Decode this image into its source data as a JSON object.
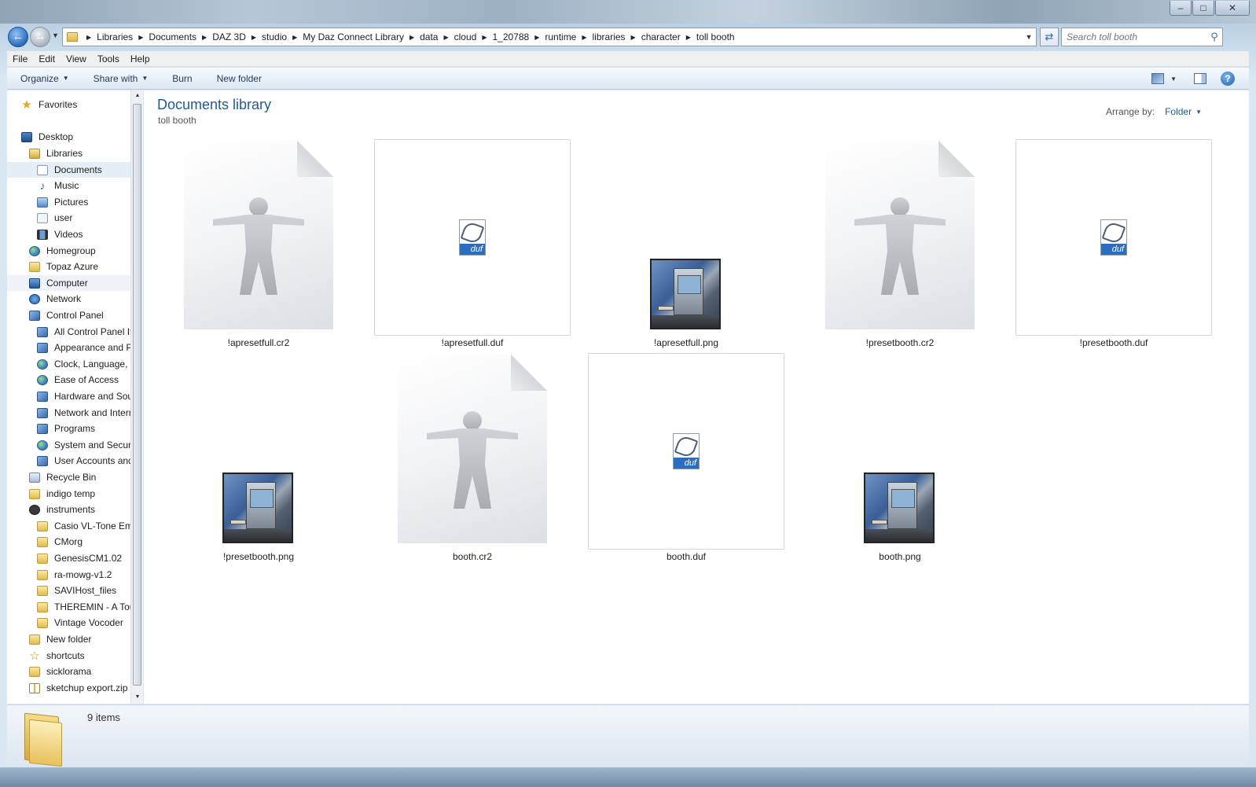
{
  "window": {
    "controls": {
      "minimize": "–",
      "maximize": "□",
      "close": "✕"
    }
  },
  "address": {
    "crumbs": [
      "Libraries",
      "Documents",
      "DAZ 3D",
      "studio",
      "My Daz Connect Library",
      "data",
      "cloud",
      "1_20788",
      "runtime",
      "libraries",
      "character",
      "toll booth"
    ],
    "search_placeholder": "Search toll booth"
  },
  "menu": [
    "File",
    "Edit",
    "View",
    "Tools",
    "Help"
  ],
  "commands": {
    "organize": "Organize",
    "share_with": "Share with",
    "burn": "Burn",
    "new_folder": "New folder"
  },
  "nav_tree": [
    {
      "label": "Favorites",
      "icon": "star-icon"
    },
    {
      "label": "Desktop",
      "icon": "desktop-icon"
    },
    {
      "label": "Libraries",
      "icon": "libraries-icon"
    },
    {
      "label": "Documents",
      "icon": "document-icon"
    },
    {
      "label": "Music",
      "icon": "music-icon"
    },
    {
      "label": "Pictures",
      "icon": "pictures-icon"
    },
    {
      "label": "user",
      "icon": "user-icon"
    },
    {
      "label": "Videos",
      "icon": "videos-icon"
    },
    {
      "label": "Homegroup",
      "icon": "homegroup-icon"
    },
    {
      "label": "Topaz Azure",
      "icon": "folder-icon"
    },
    {
      "label": "Computer",
      "icon": "computer-icon"
    },
    {
      "label": "Network",
      "icon": "network-icon"
    },
    {
      "label": "Control Panel",
      "icon": "control-panel-icon"
    },
    {
      "label": "All Control Panel It",
      "icon": "control-panel-icon"
    },
    {
      "label": "Appearance and Pe",
      "icon": "control-panel-icon"
    },
    {
      "label": "Clock, Language, a",
      "icon": "globe-icon"
    },
    {
      "label": "Ease of Access",
      "icon": "globe-icon"
    },
    {
      "label": "Hardware and Sou",
      "icon": "control-panel-icon"
    },
    {
      "label": "Network and Intern",
      "icon": "control-panel-icon"
    },
    {
      "label": "Programs",
      "icon": "control-panel-icon"
    },
    {
      "label": "System and Securit",
      "icon": "globe-icon"
    },
    {
      "label": "User Accounts and",
      "icon": "control-panel-icon"
    },
    {
      "label": "Recycle Bin",
      "icon": "recycle-bin-icon"
    },
    {
      "label": "indigo temp",
      "icon": "folder-icon"
    },
    {
      "label": "instruments",
      "icon": "instruments-icon"
    },
    {
      "label": "Casio VL-Tone Em",
      "icon": "folder-icon"
    },
    {
      "label": "CMorg",
      "icon": "folder-icon"
    },
    {
      "label": "GenesisCM1.02",
      "icon": "folder-icon"
    },
    {
      "label": "ra-mowg-v1.2",
      "icon": "folder-icon"
    },
    {
      "label": "SAVIHost_files",
      "icon": "folder-icon"
    },
    {
      "label": "THEREMIN - A Tou",
      "icon": "folder-icon"
    },
    {
      "label": "Vintage Vocoder",
      "icon": "folder-icon"
    },
    {
      "label": "New folder",
      "icon": "folder-icon"
    },
    {
      "label": "shortcuts",
      "icon": "shortcuts-icon"
    },
    {
      "label": "sicklorama",
      "icon": "folder-icon"
    },
    {
      "label": "sketchup export.zip",
      "icon": "zip-icon"
    }
  ],
  "content": {
    "title": "Documents library",
    "subtitle": "toll booth",
    "arrange_label": "Arrange by:",
    "arrange_value": "Folder",
    "files": [
      {
        "name": "!apresetfull.cr2",
        "type": "cr2"
      },
      {
        "name": "!apresetfull.duf",
        "type": "duf"
      },
      {
        "name": "!apresetfull.png",
        "type": "png"
      },
      {
        "name": "!presetbooth.cr2",
        "type": "cr2"
      },
      {
        "name": "!presetbooth.duf",
        "type": "duf"
      },
      {
        "name": "!presetbooth.png",
        "type": "png"
      },
      {
        "name": "booth.cr2",
        "type": "cr2"
      },
      {
        "name": "booth.duf",
        "type": "duf"
      },
      {
        "name": "booth.png",
        "type": "png"
      }
    ],
    "duf_tag": "duf"
  },
  "status": {
    "item_count": "9 items"
  }
}
